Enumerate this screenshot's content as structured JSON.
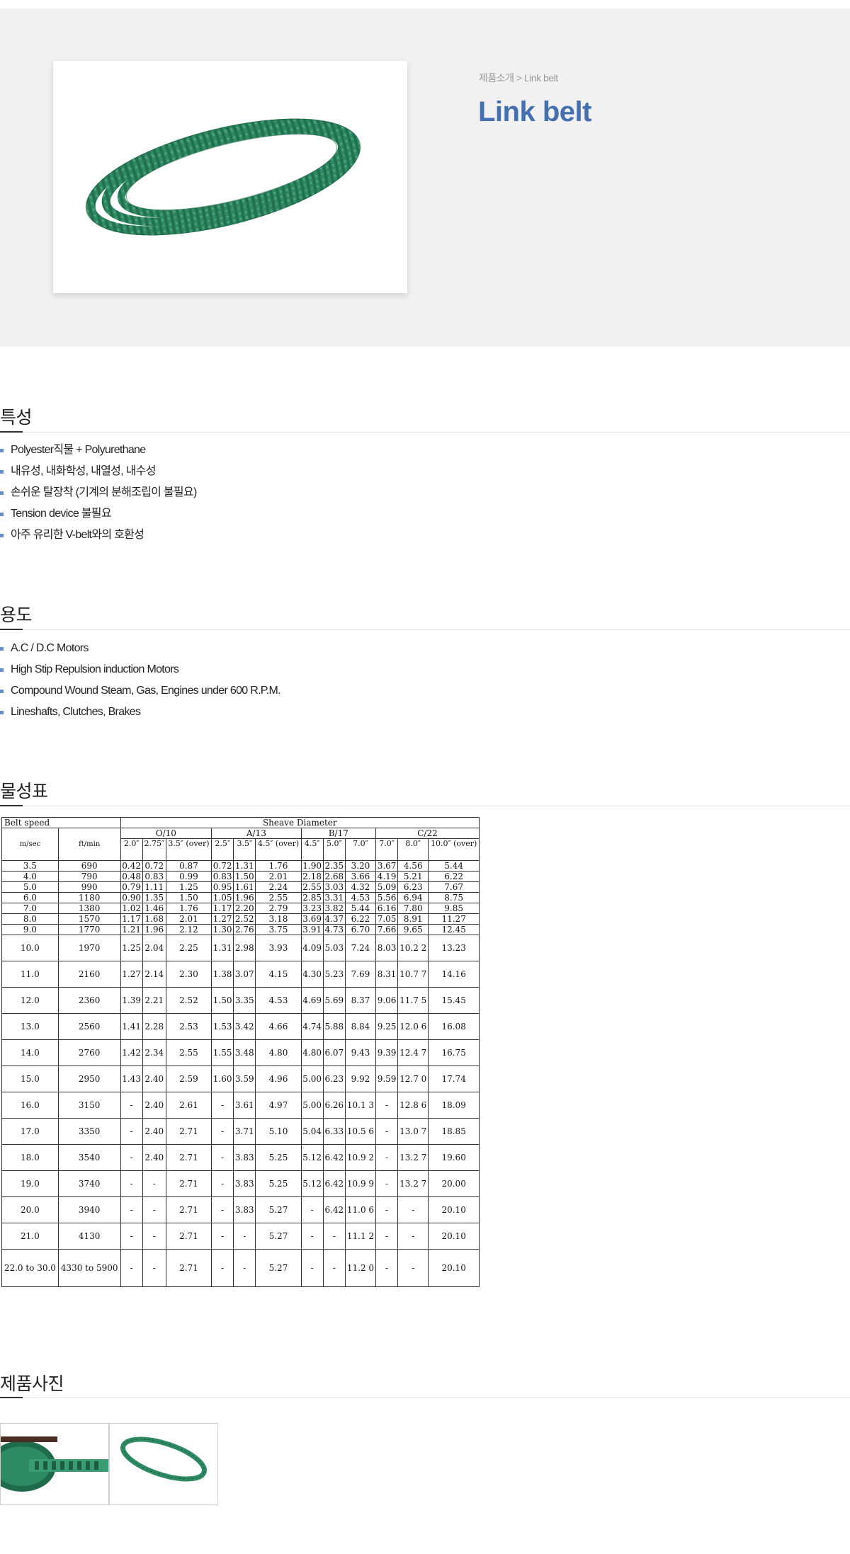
{
  "breadcrumb": "제품소개 > Link belt",
  "page_title": "Link belt",
  "features": {
    "heading": "특성",
    "items": [
      "Polyester직물 + Polyurethane",
      "내유성, 내화학성, 내열성, 내수성",
      "손쉬운 탈장착 (기계의 분해조립이 불필요)",
      "Tension device 불필요",
      "아주 유리한 V-belt와의 호환성"
    ]
  },
  "uses": {
    "heading": "용도",
    "items": [
      "A.C / D.C Motors",
      "High Stip Repulsion induction Motors",
      "Compound Wound Steam, Gas, Engines under 600 R.P.M.",
      "Lineshafts, Clutches, Brakes"
    ]
  },
  "spec": {
    "heading": "물성표",
    "belt_speed": "Belt speed",
    "sheave_diameter": "Sheave Diameter",
    "col_ms": "m/sec",
    "col_ft": "ft/min",
    "groups": [
      "O/10",
      "A/13",
      "B/17",
      "C/22"
    ],
    "sizes": [
      "2.0″",
      "2.75″",
      "3.5″ (over)",
      "2.5″",
      "3.5″",
      "4.5″ (over)",
      "4.5″",
      "5.0″",
      "7.0″",
      "7.0″",
      "8.0″",
      "10.0″ (over)"
    ],
    "rows": [
      [
        "3.5",
        "690",
        "0.42",
        "0.72",
        "0.87",
        "0.72",
        "1.31",
        "1.76",
        "1.90",
        "2.35",
        "3.20",
        "3.67",
        "4.56",
        "5.44"
      ],
      [
        "4.0",
        "790",
        "0.48",
        "0.83",
        "0.99",
        "0.83",
        "1.50",
        "2.01",
        "2.18",
        "2.68",
        "3.66",
        "4.19",
        "5.21",
        "6.22"
      ],
      [
        "5.0",
        "990",
        "0.79",
        "1.11",
        "1.25",
        "0.95",
        "1.61",
        "2.24",
        "2.55",
        "3.03",
        "4.32",
        "5.09",
        "6.23",
        "7.67"
      ],
      [
        "6.0",
        "1180",
        "0.90",
        "1.35",
        "1.50",
        "1.05",
        "1.96",
        "2.55",
        "2.85",
        "3.31",
        "4.53",
        "5.56",
        "6.94",
        "8.75"
      ],
      [
        "7.0",
        "1380",
        "1.02",
        "1.46",
        "1.76",
        "1.17",
        "2.20",
        "2.79",
        "3.23",
        "3.82",
        "5.44",
        "6.16",
        "7.80",
        "9.85"
      ],
      [
        "8.0",
        "1570",
        "1.17",
        "1.68",
        "2.01",
        "1.27",
        "2.52",
        "3.18",
        "3.69",
        "4.37",
        "6.22",
        "7.05",
        "8.91",
        "11.27"
      ],
      [
        "9.0",
        "1770",
        "1.21",
        "1.96",
        "2.12",
        "1.30",
        "2.76",
        "3.75",
        "3.91",
        "4.73",
        "6.70",
        "7.66",
        "9.65",
        "12.45"
      ],
      [
        "10.0",
        "1970",
        "1.25",
        "2.04",
        "2.25",
        "1.31",
        "2.98",
        "3.93",
        "4.09",
        "5.03",
        "7.24",
        "8.03",
        "10.2 2",
        "13.23"
      ],
      [
        "11.0",
        "2160",
        "1.27",
        "2.14",
        "2.30",
        "1.38",
        "3.07",
        "4.15",
        "4.30",
        "5.23",
        "7.69",
        "8.31",
        "10.7 7",
        "14.16"
      ],
      [
        "12.0",
        "2360",
        "1.39",
        "2.21",
        "2.52",
        "1.50",
        "3.35",
        "4.53",
        "4.69",
        "5.69",
        "8.37",
        "9.06",
        "11.7 5",
        "15.45"
      ],
      [
        "13.0",
        "2560",
        "1.41",
        "2.28",
        "2.53",
        "1.53",
        "3.42",
        "4.66",
        "4.74",
        "5.88",
        "8.84",
        "9.25",
        "12.0 6",
        "16.08"
      ],
      [
        "14.0",
        "2760",
        "1.42",
        "2.34",
        "2.55",
        "1.55",
        "3.48",
        "4.80",
        "4.80",
        "6.07",
        "9.43",
        "9.39",
        "12.4 7",
        "16.75"
      ],
      [
        "15.0",
        "2950",
        "1.43",
        "2.40",
        "2.59",
        "1.60",
        "3.59",
        "4.96",
        "5.00",
        "6.23",
        "9.92",
        "9.59",
        "12.7 0",
        "17.74"
      ],
      [
        "16.0",
        "3150",
        "-",
        "2.40",
        "2.61",
        "-",
        "3.61",
        "4.97",
        "5.00",
        "6.26",
        "10.1 3",
        "-",
        "12.8 6",
        "18.09"
      ],
      [
        "17.0",
        "3350",
        "-",
        "2.40",
        "2.71",
        "-",
        "3.71",
        "5.10",
        "5.04",
        "6.33",
        "10.5 6",
        "-",
        "13.0 7",
        "18.85"
      ],
      [
        "18.0",
        "3540",
        "-",
        "2.40",
        "2.71",
        "-",
        "3.83",
        "5.25",
        "5.12",
        "6.42",
        "10.9 2",
        "-",
        "13.2 7",
        "19.60"
      ],
      [
        "19.0",
        "3740",
        "-",
        "-",
        "2.71",
        "-",
        "3.83",
        "5.25",
        "5.12",
        "6.42",
        "10.9 9",
        "-",
        "13.2 7",
        "20.00"
      ],
      [
        "20.0",
        "3940",
        "-",
        "-",
        "2.71",
        "-",
        "3.83",
        "5.27",
        "-",
        "6.42",
        "11.0 6",
        "-",
        "-",
        "20.10"
      ],
      [
        "21.0",
        "4130",
        "-",
        "-",
        "2.71",
        "-",
        "-",
        "5.27",
        "-",
        "-",
        "11.1 2",
        "-",
        "-",
        "20.10"
      ],
      [
        "22.0 to 30.0",
        "4330 to 5900",
        "-",
        "-",
        "2.71",
        "-",
        "-",
        "5.27",
        "-",
        "-",
        "11.2 0",
        "-",
        "-",
        "20.10"
      ]
    ]
  },
  "photos": {
    "heading": "제품사진"
  },
  "colors": {
    "title_blue": "#4470b0",
    "belt_green": "#2e8a63",
    "bullet_blue": "#6a8fc8",
    "hero_bg": "#f1f1f1"
  }
}
